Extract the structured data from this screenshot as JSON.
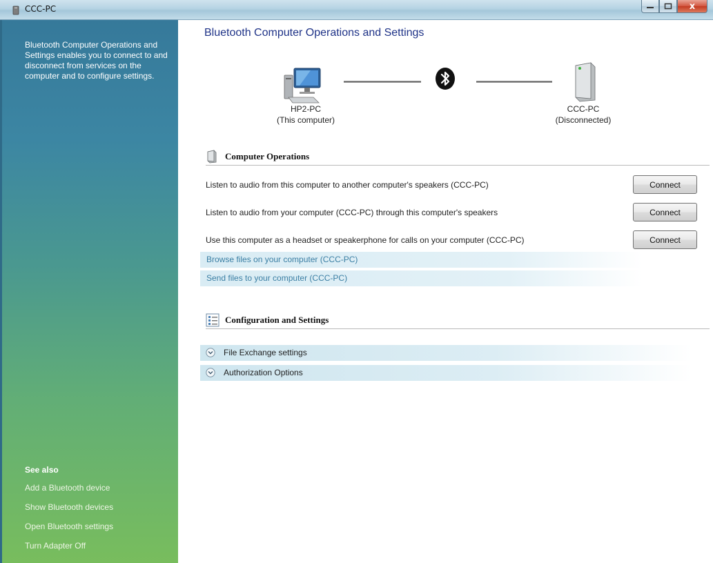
{
  "window": {
    "title": "CCC-PC",
    "icon": "bluetooth-device-icon",
    "controls": {
      "minimize": "–",
      "maximize": "□",
      "close": "x"
    }
  },
  "sidebar": {
    "description": "Bluetooth Computer Operations and Settings enables you to connect to and disconnect from services on the computer and to configure settings.",
    "see_also_title": "See also",
    "links": [
      "Add a Bluetooth device",
      "Show Bluetooth devices",
      "Open Bluetooth settings",
      "Turn Adapter Off"
    ]
  },
  "main": {
    "title": "Bluetooth Computer Operations and Settings",
    "local_device": {
      "name": "HP2-PC",
      "status": "(This computer)",
      "icon": "computer-icon"
    },
    "remote_device": {
      "name": "CCC-PC",
      "status": "(Disconnected)",
      "icon": "remote-computer-icon"
    },
    "connection_icon": "bluetooth-icon",
    "computer_operations": {
      "title": "Computer Operations",
      "operations": [
        {
          "text": "Listen to audio from this computer to another computer's speakers (CCC-PC)",
          "button": "Connect"
        },
        {
          "text": "Listen to audio from your computer (CCC-PC) through this computer's speakers",
          "button": "Connect"
        },
        {
          "text": "Use this computer as a headset or speakerphone for calls on your computer (CCC-PC)",
          "button": "Connect"
        }
      ],
      "links": [
        "Browse files on your computer (CCC-PC)",
        "Send files to your computer (CCC-PC)"
      ]
    },
    "configuration": {
      "title": "Configuration and Settings",
      "items": [
        "File Exchange settings",
        "Authorization Options"
      ]
    }
  },
  "colors": {
    "title_blue": "#1e3287",
    "link_blue": "#3a7ea3",
    "sidebar_top": "#36799a",
    "sidebar_bottom": "#78bd5d"
  }
}
